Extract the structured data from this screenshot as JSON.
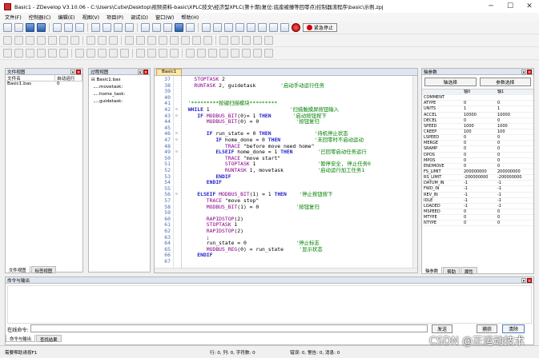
{
  "window": {
    "title": "Basic1 - ZDevelop V3.10.06 - C:\\Users\\Cutie\\Desktop\\视频资料-basic\\XPLC技文\\经济型XPLC(第十期)复位:底座被撞等回零点)控制器流程序\\basic\\示例.zpj"
  },
  "menu": [
    "文件(F)",
    "控制器(C)",
    "编辑(E)",
    "视图(V)",
    "项目(P)",
    "调试(D)",
    "窗口(W)",
    "帮助(H)"
  ],
  "toolbar": {
    "estop_label": "紧急停止"
  },
  "file_panel": {
    "title": "文件视图",
    "col_name": "文件名",
    "col_autorun": "自动运行",
    "files": [
      {
        "name": "Basic1.bas",
        "autorun": "0"
      }
    ],
    "tab_files": "文件视图",
    "tab_labels": "标签视图"
  },
  "proc_panel": {
    "title": "过程视图",
    "root": "Basic1.bas",
    "nodes": [
      "movetask:",
      "home_task:",
      "guidetask:"
    ]
  },
  "editor": {
    "tab": "Basic1",
    "lines": [
      {
        "n": "37",
        "t": "    STOPTASK 2"
      },
      {
        "n": "38",
        "t": "    RUNTASK 2, guidetask        '启动手动运行任务"
      },
      {
        "n": "39",
        "t": ""
      },
      {
        "n": "40",
        "t": ""
      },
      {
        "n": "41",
        "t": "  '*********按键扫描模块*********"
      },
      {
        "n": "42",
        "t": "  WHILE 1                          '扫描触摸屏按钮输入"
      },
      {
        "n": "43",
        "t": "     IF MODBUS_BIT(0)= 1 THEN       '启动按钮按下"
      },
      {
        "n": "44",
        "t": "        MODBUS_BIT(0) = 0            '按钮复归"
      },
      {
        "n": "45",
        "t": ""
      },
      {
        "n": "46",
        "t": "        IF run_state = 0 THEN              '待机停止状态"
      },
      {
        "n": "47",
        "t": "           IF home_done = 0 THEN           '未回零时不启动运动"
      },
      {
        "n": "48",
        "t": "              TRACE \"before move need home\""
      },
      {
        "n": "49",
        "t": "           ELSEIF home_done = 1 THEN        '已回零启动任务运行"
      },
      {
        "n": "50",
        "t": "              TRACE \"move start\""
      },
      {
        "n": "51",
        "t": "              STOPTASK 1                    '暂停安全, 停止任务0"
      },
      {
        "n": "52",
        "t": "              RUNTASK 1, movetask           '启动运行加工任务1"
      },
      {
        "n": "53",
        "t": "           ENDIF"
      },
      {
        "n": "54",
        "t": "        ENDIF"
      },
      {
        "n": "55",
        "t": ""
      },
      {
        "n": "56",
        "t": "     ELSEIF MODBUS_BIT(1) = 1 THEN    '停止按钮按下"
      },
      {
        "n": "57",
        "t": "        TRACE \"move stop\""
      },
      {
        "n": "58",
        "t": "        MODBUS_BIT(1) = 0            '按钮复归"
      },
      {
        "n": "59",
        "t": ""
      },
      {
        "n": "60",
        "t": "        RAPIDSTOP(2)"
      },
      {
        "n": "61",
        "t": "        STOPTASK 1"
      },
      {
        "n": "62",
        "t": "        RAPIDSTOP(2)"
      },
      {
        "n": "63",
        "t": "        ;"
      },
      {
        "n": "64",
        "t": "        run_state = 0                '停止标志"
      },
      {
        "n": "65",
        "t": "        MODBUS_REG(0) = run_state     '显示状态"
      },
      {
        "n": "66",
        "t": "     ENDIF"
      },
      {
        "n": "67",
        "t": ""
      }
    ]
  },
  "axis_panel": {
    "title": "轴参数",
    "btn_select_axis": "轴选择",
    "btn_select_param": "参数选择",
    "headers": [
      "",
      "轴0",
      "轴1"
    ],
    "rows": [
      [
        "COMMENT",
        "",
        ""
      ],
      [
        "ATYPE",
        "0",
        "0"
      ],
      [
        "UNITS",
        "1",
        "1"
      ],
      [
        "ACCEL",
        "10000",
        "10000"
      ],
      [
        "DECEL",
        "0",
        "0"
      ],
      [
        "SPEED",
        "1000",
        "1000"
      ],
      [
        "CREEP",
        "100",
        "100"
      ],
      [
        "LSPEED",
        "0",
        "0"
      ],
      [
        "MERGE",
        "0",
        "0"
      ],
      [
        "SRAMP",
        "0",
        "0"
      ],
      [
        "DPOS",
        "0",
        "0"
      ],
      [
        "MPOS",
        "0",
        "0"
      ],
      [
        "ENDMOVE",
        "0",
        "0"
      ],
      [
        "FS_LIMIT",
        "200000000",
        "200000000"
      ],
      [
        "RS_LIMIT",
        "-200000000",
        "-200000000"
      ],
      [
        "DATUM_IN",
        "-1",
        "-1"
      ],
      [
        "FWD_IN",
        "-1",
        "-1"
      ],
      [
        "REV_IN",
        "-1",
        "-1"
      ],
      [
        "IDLE",
        "-1",
        "-1"
      ],
      [
        "LOADED",
        "-1",
        "-1"
      ],
      [
        "MSPEED",
        "0",
        "0"
      ],
      [
        "MTYPE",
        "0",
        "0"
      ],
      [
        "NTYPE",
        "0",
        "0"
      ]
    ],
    "tab_axis": "轴参数",
    "tab_help": "帮助",
    "tab_props": "属性"
  },
  "cmd_panel": {
    "title": "命令与输出",
    "input_label": "在线命令:",
    "send": "发送",
    "capture": "捕获",
    "clear": "清除",
    "tab_cmd": "命令与输出",
    "tab_find": "查找结果"
  },
  "status": {
    "help": "需要帮助请按F1",
    "position": "行: 0, 列: 0, 字符数: 0",
    "errors": "错误: 0, 警告: 0, 消息: 0"
  },
  "watermark": "CSDN @正运动技术"
}
